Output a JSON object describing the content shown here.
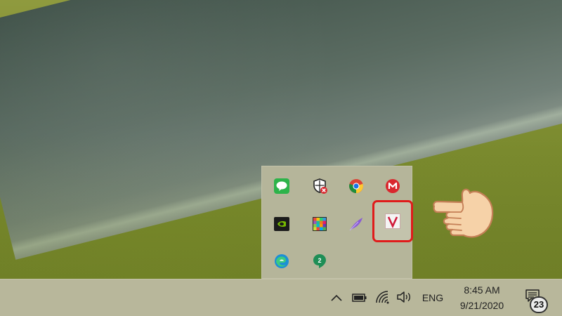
{
  "tray_overflow": {
    "icons": [
      {
        "name": "line-icon",
        "color": "#2db34a"
      },
      {
        "name": "windows-security-icon",
        "color": "#333333"
      },
      {
        "name": "chrome-icon",
        "color": "#db4437"
      },
      {
        "name": "mega-icon",
        "color": "#d9272e"
      },
      {
        "name": "nvidia-icon",
        "color": "#76b900"
      },
      {
        "name": "color-palette-icon",
        "color": "#7a5bc7"
      },
      {
        "name": "feather-icon",
        "color": "#8a5bd6"
      },
      {
        "name": "unikey-icon",
        "color": "#d0193a",
        "label": "V",
        "selected": true
      },
      {
        "name": "edge-icon",
        "color": "#1b8fd6"
      },
      {
        "name": "hangouts-icon",
        "color": "#1e8e56",
        "label": "2"
      }
    ]
  },
  "taskbar": {
    "language": "ENG",
    "time": "8:45 AM",
    "date": "9/21/2020",
    "notifications_count": "23"
  },
  "colors": {
    "highlight": "#e01b1b",
    "taskbar": "#b8b79b"
  }
}
